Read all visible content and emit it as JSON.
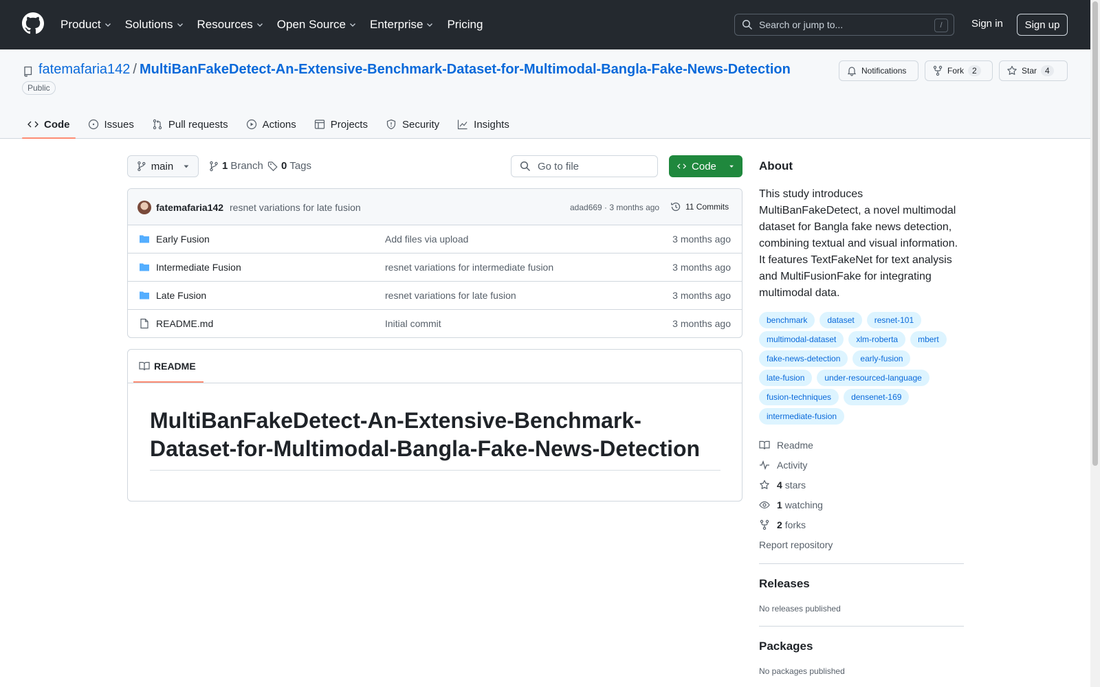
{
  "header": {
    "nav": [
      "Product",
      "Solutions",
      "Resources",
      "Open Source",
      "Enterprise",
      "Pricing"
    ],
    "search_placeholder": "Search or jump to...",
    "search_kbd": "/",
    "sign_in": "Sign in",
    "sign_up": "Sign up"
  },
  "repo": {
    "owner": "fatemafaria142",
    "separator": "/",
    "name": "MultiBanFakeDetect-An-Extensive-Benchmark-Dataset-for-Multimodal-Bangla-Fake-News-Detection",
    "visibility": "Public",
    "notifications_label": "Notifications",
    "fork_label": "Fork",
    "fork_count": "2",
    "star_label": "Star",
    "star_count": "4"
  },
  "tabs": [
    "Code",
    "Issues",
    "Pull requests",
    "Actions",
    "Projects",
    "Security",
    "Insights"
  ],
  "toolbar": {
    "branch": "main",
    "branch_count": "1",
    "branch_label": "Branch",
    "tag_count": "0",
    "tag_label": "Tags",
    "go_to_file": "Go to file",
    "code_button": "Code"
  },
  "latest_commit": {
    "author": "fatemafaria142",
    "message": "resnet variations for late fusion",
    "hash_time": "adad669 · 3 months ago",
    "commits": "11 Commits"
  },
  "files": [
    {
      "type": "folder",
      "name": "Early Fusion",
      "message": "Add files via upload",
      "time": "3 months ago"
    },
    {
      "type": "folder",
      "name": "Intermediate Fusion",
      "message": "resnet variations for intermediate fusion",
      "time": "3 months ago"
    },
    {
      "type": "folder",
      "name": "Late Fusion",
      "message": "resnet variations for late fusion",
      "time": "3 months ago"
    },
    {
      "type": "file",
      "name": "README.md",
      "message": "Initial commit",
      "time": "3 months ago"
    }
  ],
  "readme": {
    "tab_label": "README",
    "heading": "MultiBanFakeDetect-An-Extensive-Benchmark-Dataset-for-Multimodal-Bangla-Fake-News-Detection"
  },
  "about": {
    "heading": "About",
    "description": "This study introduces MultiBanFakeDetect, a novel multimodal dataset for Bangla fake news detection, combining textual and visual information. It features TextFakeNet for text analysis and MultiFusionFake for integrating multimodal data.",
    "topics": [
      "benchmark",
      "dataset",
      "resnet-101",
      "multimodal-dataset",
      "xlm-roberta",
      "mbert",
      "fake-news-detection",
      "early-fusion",
      "late-fusion",
      "under-resourced-language",
      "fusion-techniques",
      "densenet-169",
      "intermediate-fusion"
    ],
    "readme_link": "Readme",
    "activity_link": "Activity",
    "stars_count": "4",
    "stars_label": "stars",
    "watching_count": "1",
    "watching_label": "watching",
    "forks_count": "2",
    "forks_label": "forks",
    "report": "Report repository"
  },
  "releases": {
    "heading": "Releases",
    "text": "No releases published"
  },
  "packages": {
    "heading": "Packages",
    "text": "No packages published"
  },
  "colors": {
    "accent": "#0969da",
    "header_bg": "#24292f",
    "code_button": "#1f883d",
    "tab_underline": "#fd8c73"
  }
}
